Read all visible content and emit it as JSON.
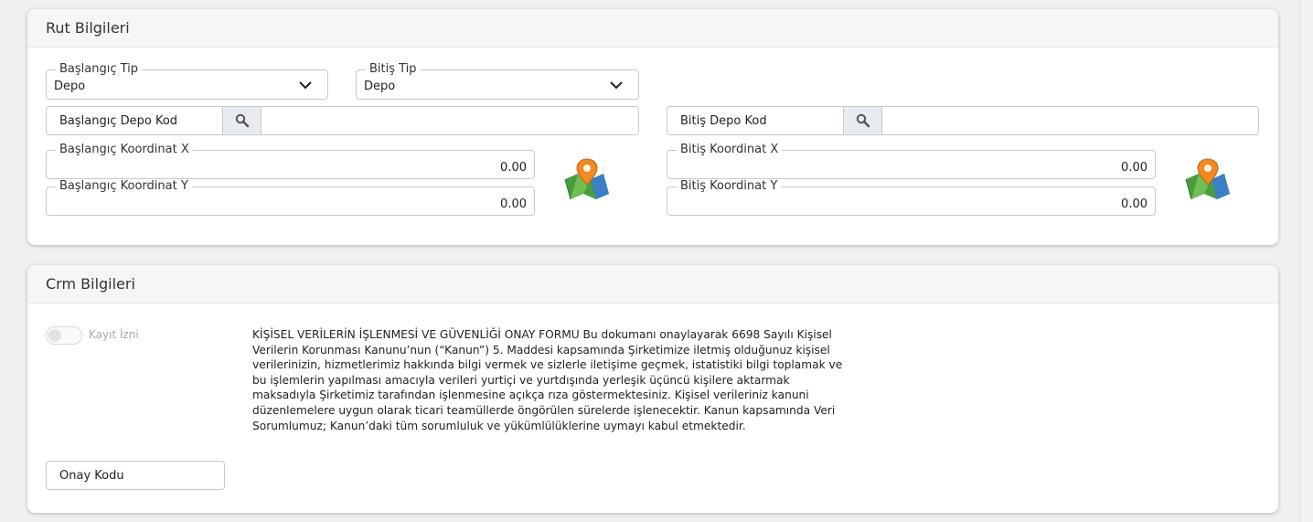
{
  "rut": {
    "title": "Rut Bilgileri",
    "baslangic_tip": {
      "label": "Başlangıç Tip",
      "value": "Depo"
    },
    "bitis_tip": {
      "label": "Bitiş Tip",
      "value": "Depo"
    },
    "baslangic_depo_kod": {
      "label": "Başlangıç Depo Kod",
      "value": ""
    },
    "bitis_depo_kod": {
      "label": "Bitiş Depo Kod",
      "value": ""
    },
    "baslangic_koordinat_x": {
      "label": "Başlangıç Koordinat X",
      "value": "0.00"
    },
    "baslangic_koordinat_y": {
      "label": "Başlangıç Koordinat Y",
      "value": "0.00"
    },
    "bitis_koordinat_x": {
      "label": "Bitiş Koordinat X",
      "value": "0.00"
    },
    "bitis_koordinat_y": {
      "label": "Bitiş Koordinat Y",
      "value": "0.00"
    }
  },
  "crm": {
    "title": "Crm Bilgileri",
    "kayit_izni": {
      "label": "Kayıt İzni",
      "checked": false
    },
    "kvkk_text": "KİŞİSEL VERİLERİN İŞLENMESİ VE GÜVENLİĞİ ONAY FORMU Bu dokumanı onaylayarak 6698 Sayılı Kişisel Verilerin Korunması Kanunu’nun (“Kanun”) 5. Maddesi kapsamında Şirketimize iletmiş olduğunuz kişisel verilerinizin, hizmetlerimiz hakkında bilgi vermek ve sizlerle iletişime geçmek, istatistiki bilgi toplamak ve bu işlemlerin yapılması amacıyla verileri yurtiçi ve yurtdışında yerleşik üçüncü kişilere aktarmak maksadıyla Şirketimiz tarafından işlenmesine açıkça rıza göstermektesiniz. Kişisel verileriniz kanuni düzenlemelere uygun olarak ticari teamüllerde öngörülen sürelerde işlenecektir. Kanun kapsamında Veri Sorumlumuz; Kanun’daki tüm sorumluluk ve yükümlülüklerine uymayı kabul etmektedir.",
    "onay_kodu": {
      "label": "Onay Kodu"
    }
  },
  "icons": {
    "chevron": "chevron-down-icon",
    "search": "search-icon",
    "map": "map-pin-icon"
  }
}
